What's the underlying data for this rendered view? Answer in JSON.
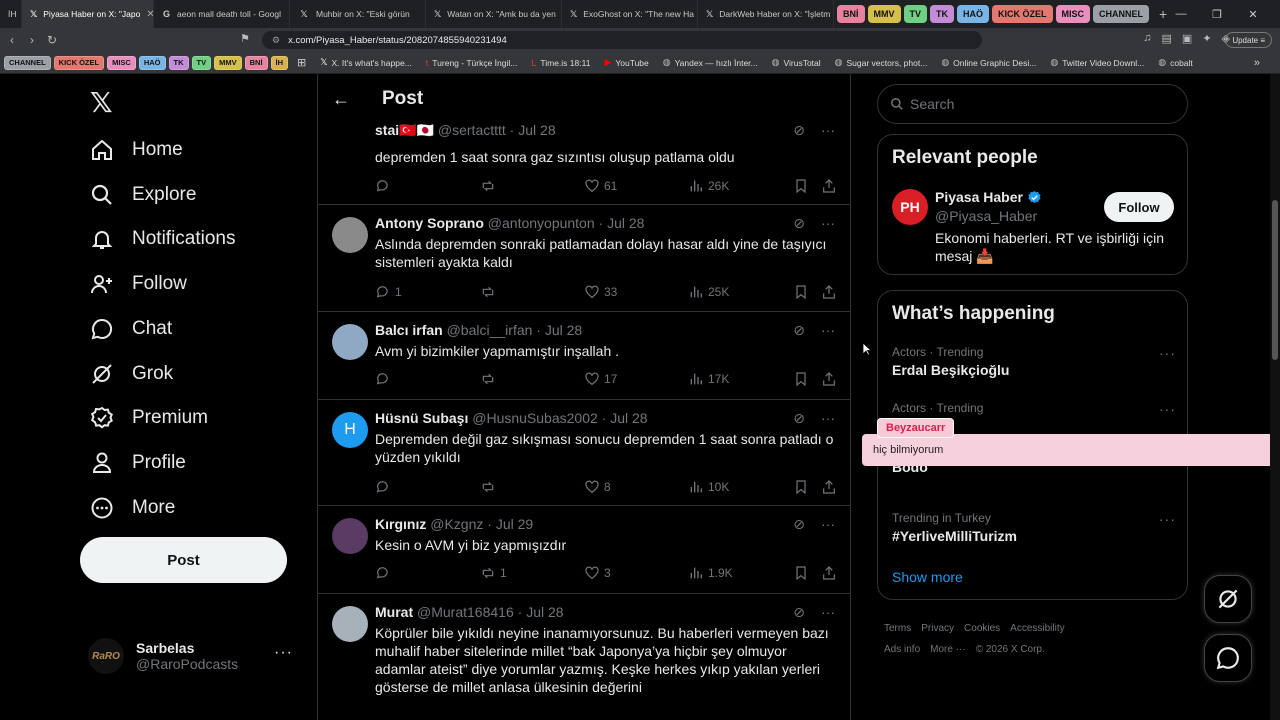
{
  "browser": {
    "tabs": [
      {
        "label": "İH",
        "active": false
      },
      {
        "label": "Piyasa Haber on X: \"Japo",
        "active": true
      },
      {
        "label": "aeon mall death toll - Googl",
        "active": false
      },
      {
        "label": "Muhbir on X: \"Eski görün",
        "active": false
      },
      {
        "label": "Watan on X: \"Amk bu da yen",
        "active": false
      },
      {
        "label": "ExoGhost on X: \"The new Ha",
        "active": false
      },
      {
        "label": "DarkWeb Haber on X: \"İşletm",
        "active": false
      }
    ],
    "tab_groups": [
      {
        "label": "BNİ",
        "color": "#e8829e"
      },
      {
        "label": "MMV",
        "color": "#d5c04a"
      },
      {
        "label": "TV",
        "color": "#6fcf83"
      },
      {
        "label": "TK",
        "color": "#c48bd6"
      },
      {
        "label": "HAÖ",
        "color": "#79b4e6"
      },
      {
        "label": "KICK ÖZEL",
        "color": "#e4776e"
      },
      {
        "label": "MISC",
        "color": "#e88fbe"
      },
      {
        "label": "CHANNEL",
        "color": "#9aa0a6"
      }
    ],
    "url": "x.com/Piyasa_Haber/status/2082074855940231494",
    "update_label": "Update",
    "bookmark_groups": [
      {
        "label": "CHANNEL",
        "color": "#9aa0a6"
      },
      {
        "label": "KICK ÖZEL",
        "color": "#e4776e"
      },
      {
        "label": "MISC",
        "color": "#e88fbe"
      },
      {
        "label": "HAÖ",
        "color": "#79b4e6"
      },
      {
        "label": "TK",
        "color": "#c48bd6"
      },
      {
        "label": "TV",
        "color": "#6fcf83"
      },
      {
        "label": "MMV",
        "color": "#d5c04a"
      },
      {
        "label": "BNİ",
        "color": "#e8829e"
      },
      {
        "label": "İH",
        "color": "#d9b24e"
      }
    ],
    "bookmarks": [
      {
        "label": "X. It's what's happe...",
        "icon": "x-icon"
      },
      {
        "label": "Tureng - Türkçe İngil...",
        "icon": "t-icon"
      },
      {
        "label": "Time.is 18:11",
        "icon": "time-icon"
      },
      {
        "label": "YouTube",
        "icon": "youtube-icon"
      },
      {
        "label": "Yandex — hızlı İnter...",
        "icon": "globe-icon"
      },
      {
        "label": "VirusTotal",
        "icon": "globe-icon"
      },
      {
        "label": "Sugar vectors, phot...",
        "icon": "globe-icon"
      },
      {
        "label": "Online Graphic Desi...",
        "icon": "globe-icon"
      },
      {
        "label": "Twitter Video Downl...",
        "icon": "globe-icon"
      },
      {
        "label": "cobalt",
        "icon": "globe-icon"
      }
    ]
  },
  "nav": {
    "items": [
      {
        "label": "Home",
        "icon": "home-icon"
      },
      {
        "label": "Explore",
        "icon": "search-icon"
      },
      {
        "label": "Notifications",
        "icon": "bell-icon"
      },
      {
        "label": "Follow",
        "icon": "follow-icon"
      },
      {
        "label": "Chat",
        "icon": "chat-icon"
      },
      {
        "label": "Grok",
        "icon": "grok-icon"
      },
      {
        "label": "Premium",
        "icon": "premium-icon"
      },
      {
        "label": "Profile",
        "icon": "profile-icon"
      },
      {
        "label": "More",
        "icon": "more-icon"
      }
    ],
    "post_label": "Post",
    "account": {
      "name": "Sarbelas",
      "handle": "@RaroPodcasts",
      "avatar_text": "RaRO"
    }
  },
  "center": {
    "title": "Post",
    "replies": [
      {
        "name": "stai",
        "flags": "🇹🇷🇯🇵",
        "handle": "@sertactttt",
        "date": "Jul 28",
        "text": "depremden 1 saat sonra gaz sızıntısı oluşup patlama oldu",
        "replies": "",
        "reposts": "",
        "likes": "61",
        "views": "26K",
        "avatar_color": "#000000"
      },
      {
        "name": "Antony Soprano",
        "flags": "",
        "handle": "@antonyopunton",
        "date": "Jul 28",
        "text": "Aslında depremden sonraki patlamadan dolayı hasar aldı yine de taşıyıcı sistemleri ayakta kaldı",
        "replies": "1",
        "reposts": "",
        "likes": "33",
        "views": "25K",
        "avatar_color": "#8a8a8a"
      },
      {
        "name": "Balcı irfan",
        "flags": "",
        "handle": "@balci__irfan",
        "date": "Jul 28",
        "text": "Avm yi bizimkiler yapmamıştır inşallah .",
        "replies": "",
        "reposts": "",
        "likes": "17",
        "views": "17K",
        "avatar_color": "#8fa8c4"
      },
      {
        "name": "Hüsnü Subaşı",
        "flags": "",
        "handle": "@HusnuSubas2002",
        "date": "Jul 28",
        "text": "Depremden değil gaz sıkışması sonucu depremden 1 saat sonra patladı o yüzden yıkıldı",
        "replies": "",
        "reposts": "",
        "likes": "8",
        "views": "10K",
        "avatar_color": "#1d9bf0",
        "avatar_letter": "H"
      },
      {
        "name": "Kırgınız",
        "flags": "",
        "handle": "@Kzgnz",
        "date": "Jul 29",
        "text": "Kesin o AVM yi biz yapmışızdır",
        "replies": "",
        "reposts": "1",
        "likes": "3",
        "views": "1.9K",
        "avatar_color": "#5a3b63"
      },
      {
        "name": "Murat",
        "flags": "",
        "handle": "@Murat168416",
        "date": "Jul 28",
        "text": "Köprüler bile yıkıldı neyine inanamıyorsunuz. Bu haberleri vermeyen bazı muhalif haber sitelerinde millet “bak Japonya’ya hiçbir şey olmuyor adamlar ateist” diye yorumlar yazmış. Keşke herkes yıkıp yakılan yerleri gösterse de millet anlasa ülkesinin değerini",
        "replies": "",
        "reposts": "",
        "likes": "",
        "views": "",
        "avatar_color": "#a7b1b9"
      }
    ]
  },
  "right": {
    "search_placeholder": "Search",
    "relevant_title": "Relevant people",
    "person": {
      "name": "Piyasa Haber",
      "handle": "@Piyasa_Haber",
      "bio": "Ekonomi haberleri. RT ve işbirliği için mesaj 📥",
      "avatar_text": "PH",
      "follow_label": "Follow"
    },
    "happening_title": "What’s happening",
    "trends": [
      {
        "context": "Actors · Trending",
        "title": "Erdal Beşikçioğlu"
      },
      {
        "context": "Actors · Trending",
        "title": "...inçci"
      },
      {
        "context": "",
        "title": "Bodo"
      },
      {
        "context": "Trending in Turkey",
        "title": "#YerliveMilliTurizm"
      }
    ],
    "show_more": "Show more",
    "footer": [
      "Terms",
      "Privacy",
      "Cookies",
      "Accessibility",
      "Ads info",
      "More ···",
      "© 2026 X Corp."
    ]
  },
  "overlay": {
    "chat_user": "Beyzaucarr",
    "chat_message": "hiç bilmiyorum"
  }
}
